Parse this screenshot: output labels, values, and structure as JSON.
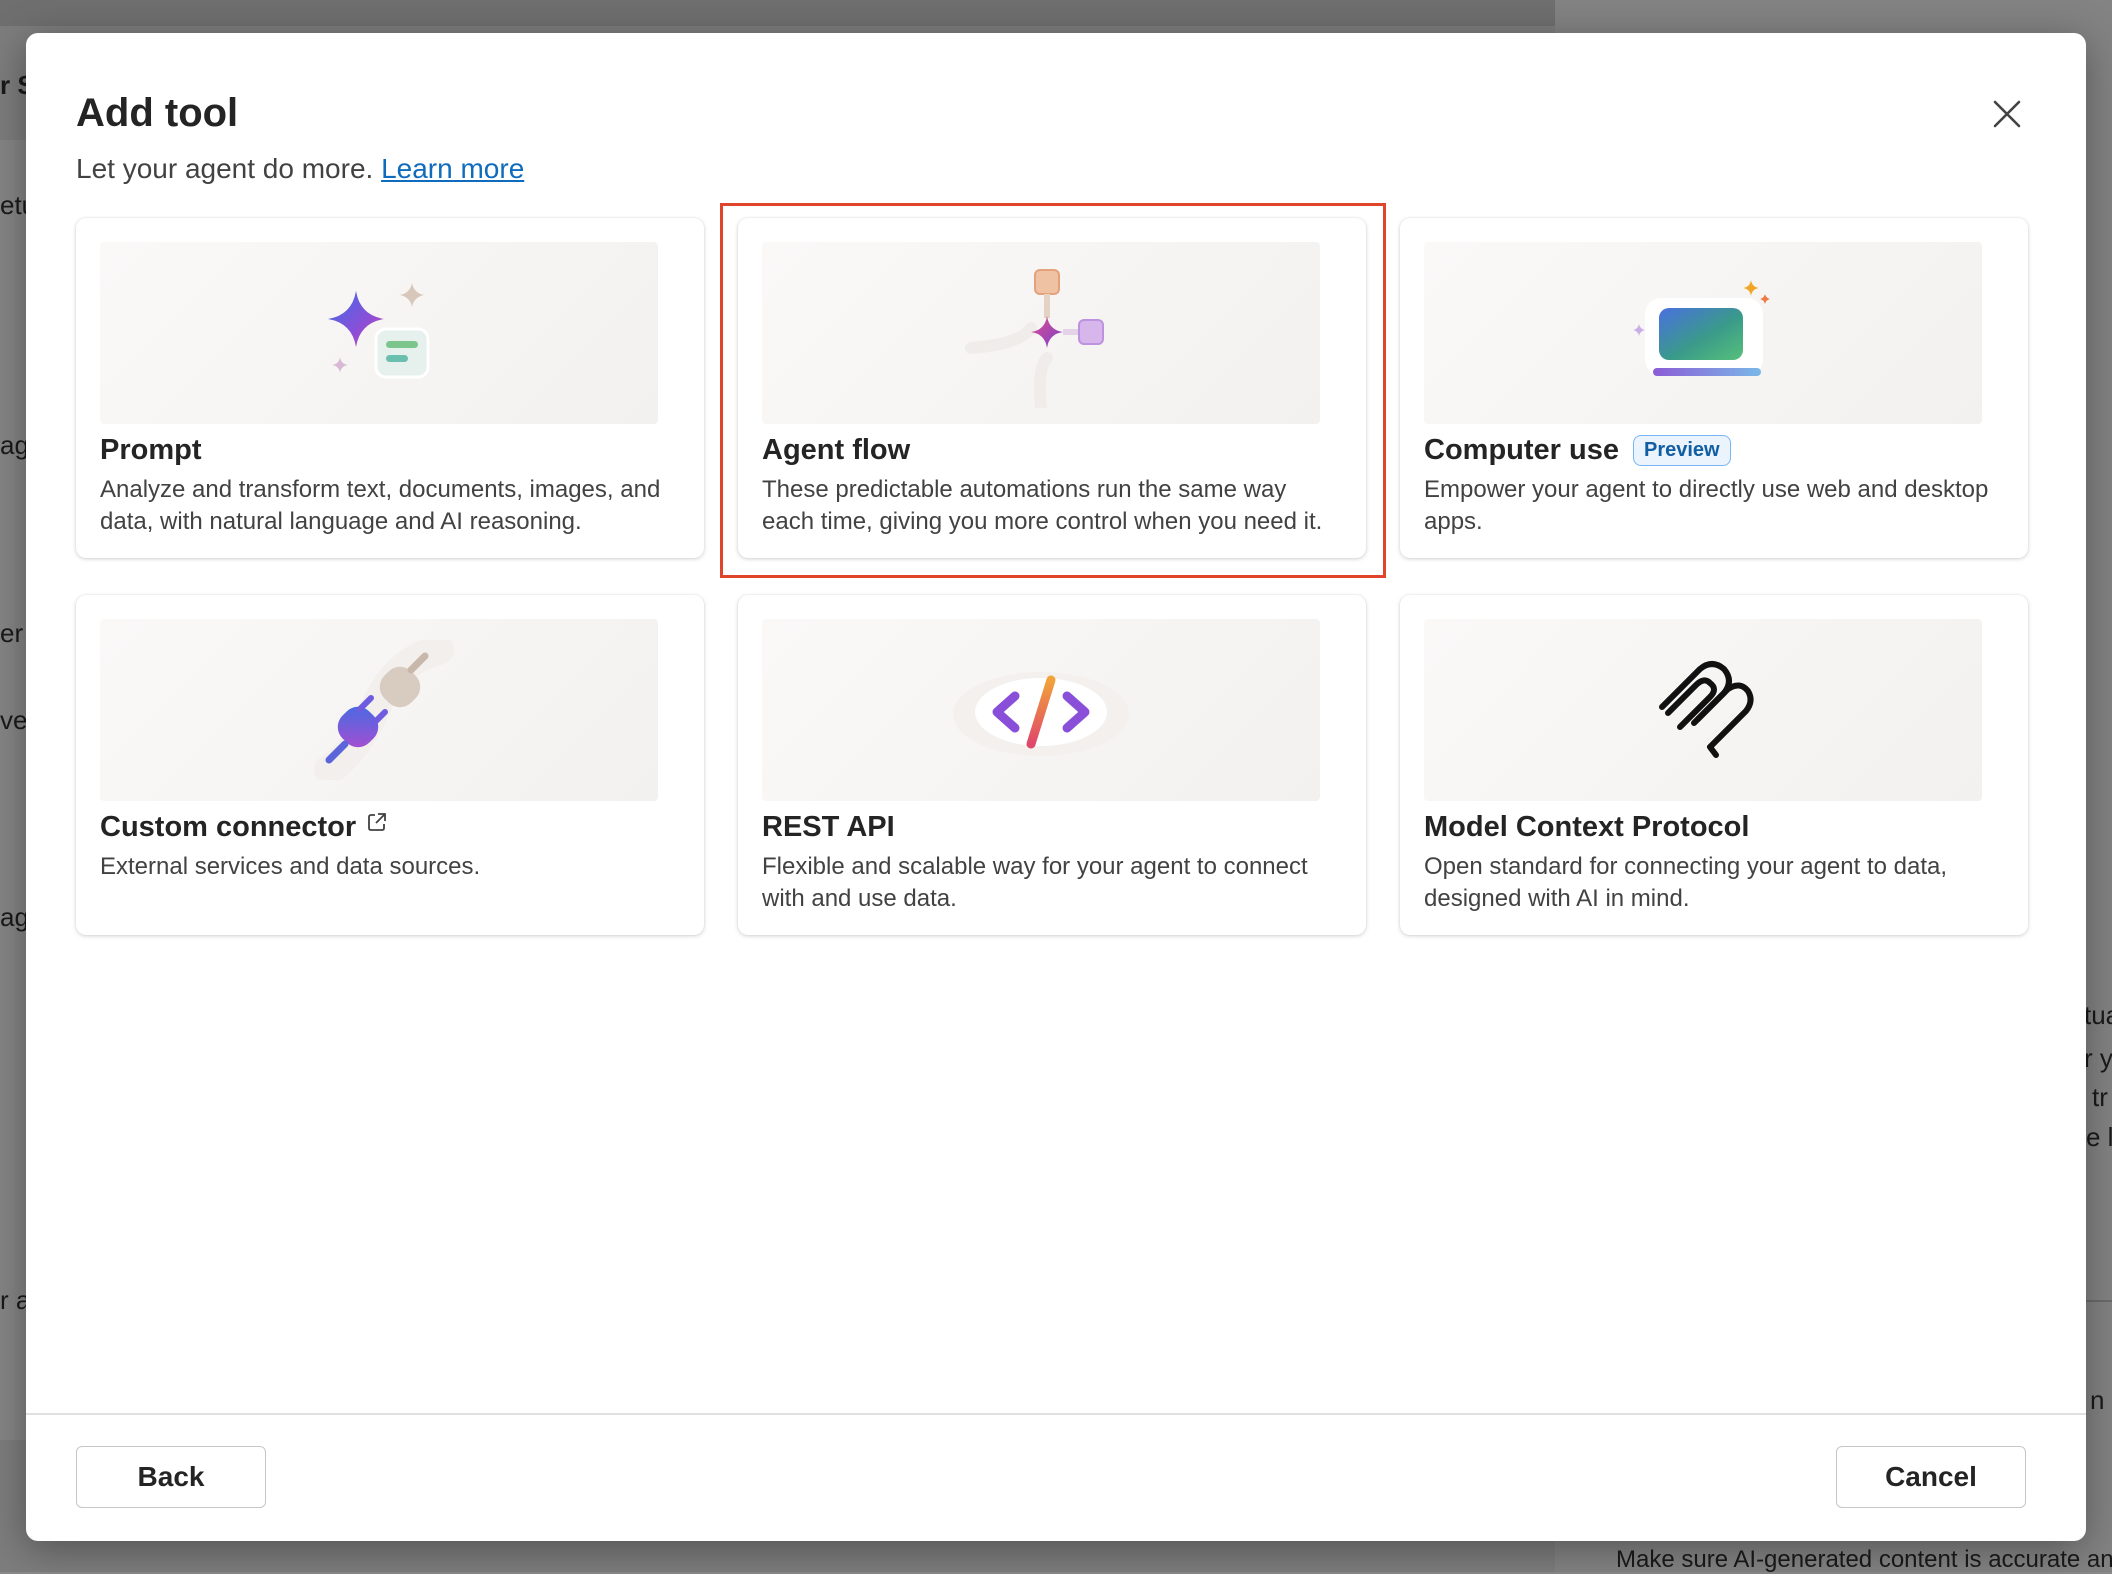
{
  "background": {
    "fragments": [
      "r S",
      "etu",
      "ag",
      "er",
      "ve",
      "ag",
      "r a",
      "tua",
      "r y",
      "tr",
      "e l",
      "n",
      "Make sure AI-generated content is accurate and"
    ]
  },
  "dialog": {
    "title": "Add tool",
    "subtitle": "Let your agent do more.",
    "learn_more": "Learn more",
    "close_icon": "close-icon"
  },
  "cards": [
    {
      "title": "Prompt",
      "description": "Analyze and transform text, documents, images, and data, with natural language and AI reasoning.",
      "icon": "prompt-sparkle-icon"
    },
    {
      "title": "Agent flow",
      "description": "These predictable automations run the same way each time, giving you more control when you need it.",
      "icon": "agent-flow-icon",
      "highlighted": true
    },
    {
      "title": "Computer use",
      "badge": "Preview",
      "description": "Empower your agent to directly use web and desktop apps.",
      "icon": "computer-use-icon"
    },
    {
      "title": "Custom connector",
      "description": "External services and data sources.",
      "icon": "plug-icon",
      "title_icon": "external-link-icon"
    },
    {
      "title": "REST API",
      "description": "Flexible and scalable way for your agent to connect with and use data.",
      "icon": "code-icon"
    },
    {
      "title": "Model Context Protocol",
      "description": "Open standard for connecting your agent to data, designed with AI in mind.",
      "icon": "mcp-icon"
    }
  ],
  "footer": {
    "back_label": "Back",
    "cancel_label": "Cancel"
  },
  "colors": {
    "highlight": "#e0442b",
    "link": "#0f6cbd"
  }
}
